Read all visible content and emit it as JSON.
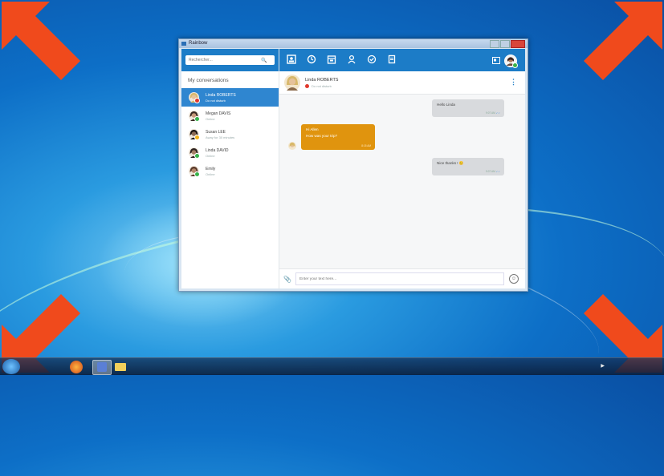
{
  "window": {
    "title": "Rainbow"
  },
  "search": {
    "placeholder": "Rechercher..."
  },
  "sidebar": {
    "title": "My conversations",
    "conversations": [
      {
        "name": "Linda ROBERTS",
        "status": "Do not disturb",
        "dot": "#e0392d",
        "active": true,
        "skin": "#e6c29a",
        "hair": "#d8b86a"
      },
      {
        "name": "Megan DAVIS",
        "status": "Online",
        "dot": "#38b34a",
        "active": false,
        "skin": "#c79a7b",
        "hair": "#3a2a22"
      },
      {
        "name": "Susan LEE",
        "status": "Away for 30 minutes",
        "dot": "#f2b31b",
        "active": false,
        "skin": "#8a6a55",
        "hair": "#1b1412"
      },
      {
        "name": "Linda DAVID",
        "status": "Online",
        "dot": "#38b34a",
        "active": false,
        "skin": "#a37d63",
        "hair": "#2e2320"
      },
      {
        "name": "Emily",
        "status": "Online",
        "dot": "#38b34a",
        "active": false,
        "skin": "#b4876a",
        "hair": "#5a3a2a"
      }
    ]
  },
  "topbar": {
    "icons": [
      "contacts-icon",
      "history-icon",
      "calendar-icon",
      "user-icon",
      "check-icon",
      "document-icon"
    ]
  },
  "contact": {
    "name": "Linda ROBERTS",
    "status": "Do not disturb"
  },
  "messages": [
    {
      "dir": "out",
      "text": "Hello Linda",
      "time": "9:07 AM"
    },
    {
      "dir": "in",
      "text_line1": "Hi Allen",
      "text_line2": "How was your trip?",
      "time": "8:15 AM"
    },
    {
      "dir": "out",
      "text": "Nice thanks ! 😊",
      "time": "9:07 AM"
    }
  ],
  "composer": {
    "placeholder": "Enter your text here..."
  },
  "colors": {
    "brand": "#1c7cc7",
    "incoming": "#e0940e",
    "outgoing": "#d8dadd",
    "arrow": "#f04a1c"
  }
}
